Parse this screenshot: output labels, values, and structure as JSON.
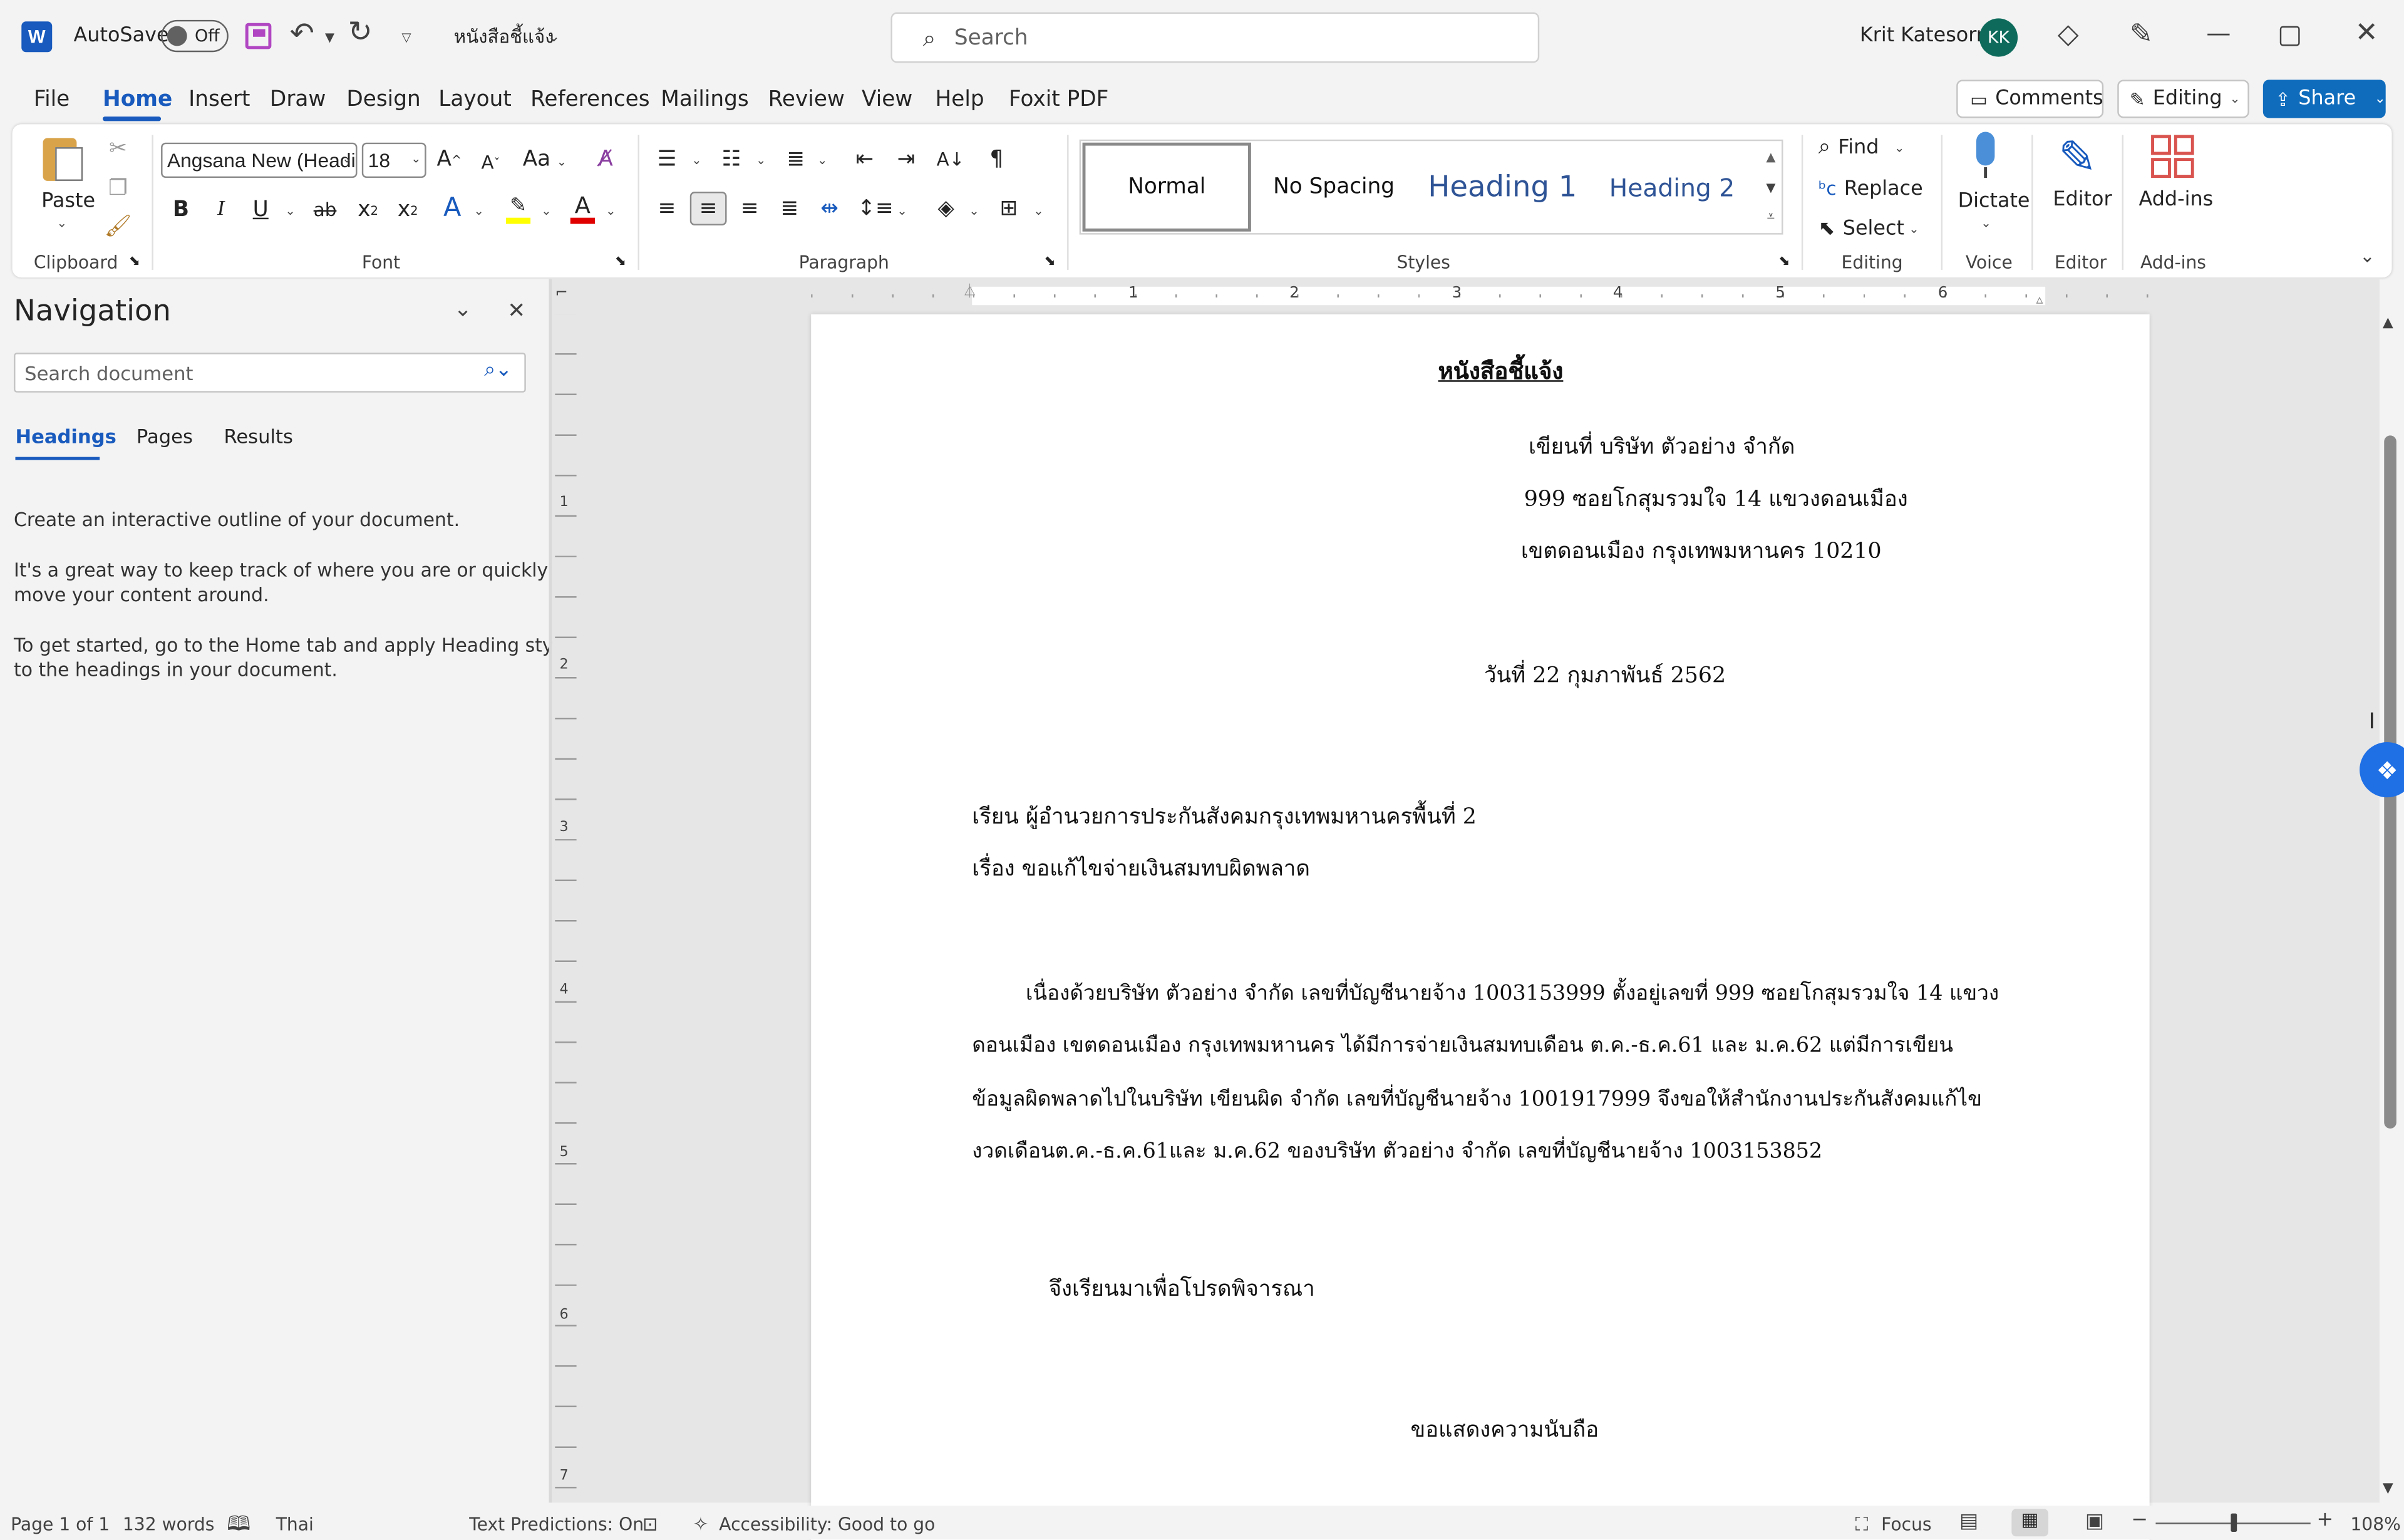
{
  "titlebar": {
    "autosave_label": "AutoSave",
    "autosave_state": "Off",
    "doc_title": "หนังสือชี้แจ้ง",
    "search_placeholder": "Search",
    "user_name": "Krit Katesorn",
    "user_initials": "KK"
  },
  "menu": [
    "File",
    "Home",
    "Insert",
    "Draw",
    "Design",
    "Layout",
    "References",
    "Mailings",
    "Review",
    "View",
    "Help",
    "Foxit PDF"
  ],
  "menu_right": {
    "comments": "Comments",
    "editing": "Editing",
    "share": "Share"
  },
  "ribbon": {
    "clipboard": {
      "paste": "Paste",
      "label": "Clipboard"
    },
    "font": {
      "family": "Angsana New (Headi",
      "size": "18",
      "label": "Font",
      "change_case": "Aa"
    },
    "paragraph": {
      "label": "Paragraph"
    },
    "styles": {
      "label": "Styles",
      "items": [
        "Normal",
        "No Spacing",
        "Heading 1",
        "Heading 2"
      ]
    },
    "editing": {
      "label": "Editing",
      "find": "Find",
      "replace": "Replace",
      "select": "Select"
    },
    "voice": {
      "label": "Voice",
      "dictate": "Dictate"
    },
    "editor": {
      "label": "Editor",
      "button": "Editor"
    },
    "addins": {
      "label": "Add-ins",
      "button": "Add-ins"
    }
  },
  "navigation": {
    "title": "Navigation",
    "search_placeholder": "Search document",
    "tabs": [
      "Headings",
      "Pages",
      "Results"
    ],
    "active_tab": "Headings",
    "p1": "Create an interactive outline of your document.",
    "p2a": "It's a great way to keep track of where you are or quickly",
    "p2b": "move your content around.",
    "p3a": "To get started, go to the Home tab and apply Heading styles",
    "p3b": "to the headings in your document."
  },
  "ruler": {
    "h": [
      "1",
      "2",
      "3",
      "4",
      "5",
      "6"
    ],
    "v": [
      "1",
      "2",
      "3",
      "4",
      "5",
      "6",
      "7"
    ]
  },
  "document": {
    "title": "หนังสือชี้แจ้ง",
    "addr1": "เขียนที่ บริษัท ตัวอย่าง จำกัด",
    "addr2": "999 ซอยโกสุมรวมใจ 14 แขวงดอนเมือง",
    "addr3": "เขตดอนเมือง กรุงเทพมหานคร 10210",
    "date": "วันที่ 22 กุมภาพันธ์ 2562",
    "to": "เรียน ผู้อำนวยการประกันสังคมกรุงเทพมหานครพื้นที่ 2",
    "subject": "เรื่อง ขอแก้ไขจ่ายเงินสมทบผิดพลาด",
    "body1": "เนื่องด้วยบริษัท ตัวอย่าง จำกัด เลขที่บัญชีนายจ้าง 1003153999 ตั้งอยู่เลขที่ 999 ซอยโกสุมรวมใจ 14 แขวง",
    "body2": "ดอนเมือง เขตดอนเมือง กรุงเทพมหานคร ได้มีการจ่ายเงินสมทบเดือน ต.ค.-ธ.ค.61 และ ม.ค.62 แต่มีการเขียน",
    "body3": "ข้อมูลผิดพลาดไปในบริษัท เขียนผิด จำกัด เลขที่บัญชีนายจ้าง 1001917999 จึงขอให้สำนักงานประกันสังคมแก้ไข",
    "body4": "งวดเดือนต.ค.-ธ.ค.61และ ม.ค.62 ของบริษัท ตัวอย่าง จำกัด เลขที่บัญชีนายจ้าง 1003153852",
    "closing1": "จึงเรียนมาเพื่อโปรดพิจารณา",
    "closing2": "ขอแสดงความนับถือ"
  },
  "status": {
    "page": "Page 1 of 1",
    "words": "132 words",
    "language": "Thai",
    "predictions": "Text Predictions: On",
    "accessibility": "Accessibility: Good to go",
    "focus": "Focus",
    "zoom": "108%"
  },
  "colors": {
    "word_blue": "#185abd",
    "share_blue": "#0f6cbd",
    "heading_blue": "#2f5496",
    "highlight": "#ffff00",
    "font_red": "#e00000",
    "addins_red": "#d9534f"
  }
}
